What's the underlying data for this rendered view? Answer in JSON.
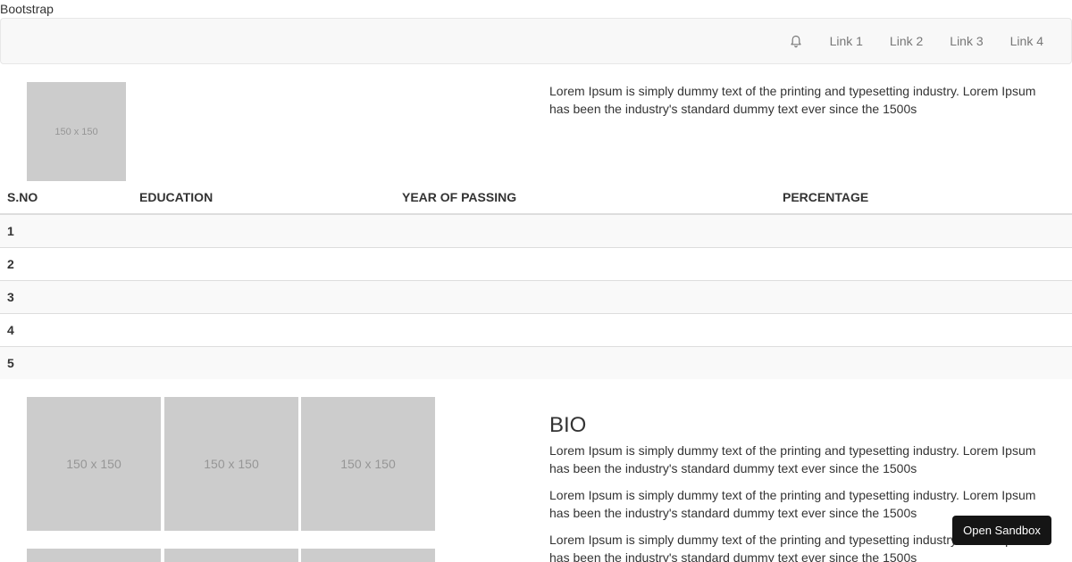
{
  "page": {
    "label": "Bootstrap"
  },
  "navbar": {
    "bell_icon": "bell-icon",
    "links": [
      "Link 1",
      "Link 2",
      "Link 3",
      "Link 4"
    ]
  },
  "profile": {
    "image_label": "150 x 150",
    "intro_text": "Lorem Ipsum is simply dummy text of the printing and typesetting industry. Lorem Ipsum has been the industry's standard dummy text ever since the 1500s"
  },
  "education_table": {
    "headers": [
      "S.NO",
      "EDUCATION",
      "YEAR OF PASSING",
      "PERCENTAGE"
    ],
    "rows": [
      {
        "sno": "1",
        "education": "",
        "year": "",
        "percentage": ""
      },
      {
        "sno": "2",
        "education": "",
        "year": "",
        "percentage": ""
      },
      {
        "sno": "3",
        "education": "",
        "year": "",
        "percentage": ""
      },
      {
        "sno": "4",
        "education": "",
        "year": "",
        "percentage": ""
      },
      {
        "sno": "5",
        "education": "",
        "year": "",
        "percentage": ""
      }
    ]
  },
  "gallery": {
    "images": [
      "150 x 150",
      "150 x 150",
      "150 x 150",
      "",
      "",
      ""
    ]
  },
  "bio": {
    "title": "BIO",
    "paragraphs": [
      "Lorem Ipsum is simply dummy text of the printing and typesetting industry. Lorem Ipsum has been the industry's standard dummy text ever since the 1500s",
      "Lorem Ipsum is simply dummy text of the printing and typesetting industry. Lorem Ipsum has been the industry's standard dummy text ever since the 1500s",
      "Lorem Ipsum is simply dummy text of the printing and typesetting industry. Lorem Ipsum has been the industry's standard dummy text ever since the 1500s"
    ]
  },
  "sandbox_button": {
    "label": "Open Sandbox"
  }
}
